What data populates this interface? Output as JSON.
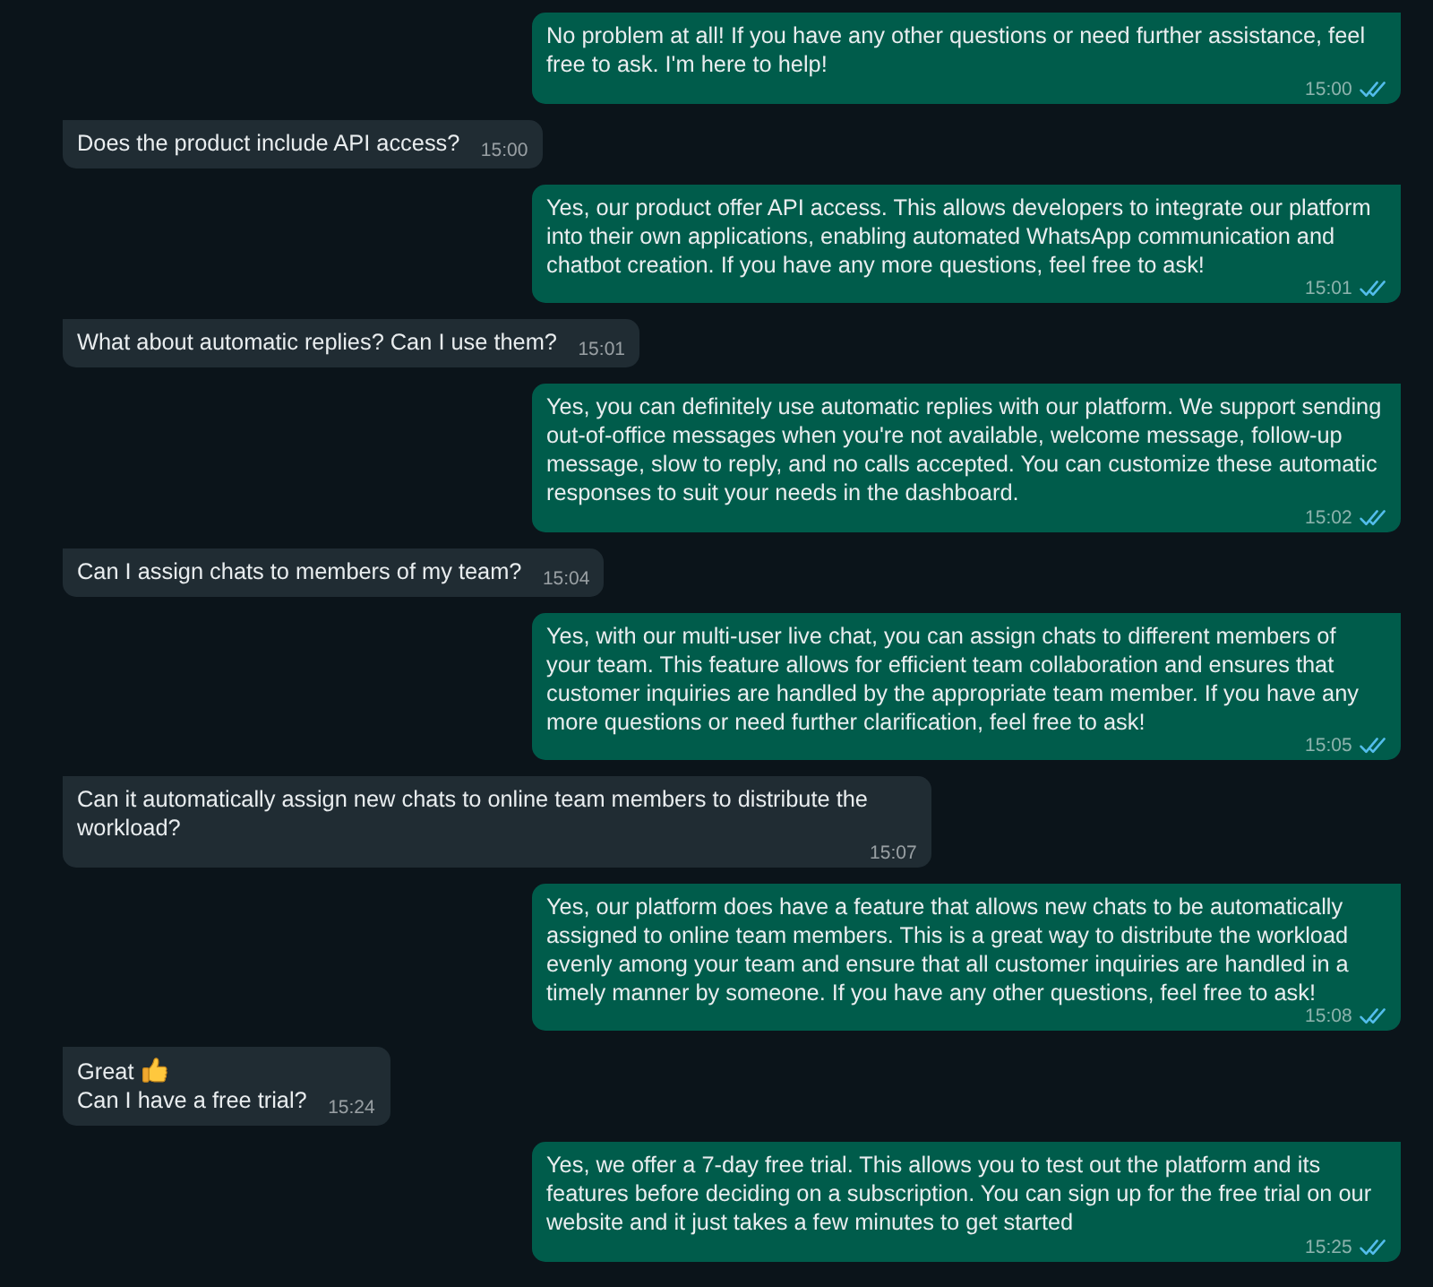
{
  "messages": [
    {
      "kind": "outgoing",
      "paragraphs": [
        {
          "text": "No problem at all! If you have any other questions or need further assistance, feel free to ask. I'm here to help!",
          "thumbs_up": false
        }
      ],
      "time": "15:00",
      "read": true
    },
    {
      "kind": "incoming",
      "paragraphs": [
        {
          "text": "Does the product include API access?",
          "thumbs_up": false
        }
      ],
      "time": "15:00"
    },
    {
      "kind": "outgoing",
      "paragraphs": [
        {
          "text": "Yes, our product offer API access. This allows developers to integrate our platform into their own applications, enabling automated WhatsApp communication and chatbot creation. If you have any more questions, feel free to ask!",
          "thumbs_up": false
        }
      ],
      "time": "15:01",
      "read": true
    },
    {
      "kind": "incoming",
      "paragraphs": [
        {
          "text": "What about automatic replies? Can I use them?",
          "thumbs_up": false
        }
      ],
      "time": "15:01"
    },
    {
      "kind": "outgoing",
      "paragraphs": [
        {
          "text": "Yes, you can definitely use automatic replies with our platform. We support sending out-of-office messages when you're not available, welcome message, follow-up message, slow to reply, and no calls accepted. You can customize these automatic responses to suit your needs in the dashboard.",
          "thumbs_up": false
        }
      ],
      "time": "15:02",
      "read": true
    },
    {
      "kind": "incoming",
      "paragraphs": [
        {
          "text": "Can I assign chats to members of my team?",
          "thumbs_up": false
        }
      ],
      "time": "15:04"
    },
    {
      "kind": "outgoing",
      "paragraphs": [
        {
          "text": "Yes, with our multi-user live chat, you can assign chats to different members of your team. This feature allows for efficient team collaboration and ensures that customer inquiries are handled by the appropriate team member. If you have any more questions or need further clarification, feel free to ask!",
          "thumbs_up": false
        }
      ],
      "time": "15:05",
      "read": true
    },
    {
      "kind": "incoming",
      "paragraphs": [
        {
          "text": "Can it automatically assign new chats to online team members to distribute the workload?",
          "thumbs_up": false
        }
      ],
      "time": "15:07"
    },
    {
      "kind": "outgoing",
      "paragraphs": [
        {
          "text": "Yes, our platform does have a feature that allows new chats to be automatically assigned to online team members. This is a great way to distribute the workload evenly among your team and ensure that all customer inquiries are handled in a timely manner by someone. If you have any other questions, feel free to ask!",
          "thumbs_up": false
        }
      ],
      "time": "15:08",
      "read": true
    },
    {
      "kind": "incoming",
      "paragraphs": [
        {
          "text": "Great",
          "thumbs_up": true
        },
        {
          "text": "Can I have a free trial?",
          "thumbs_up": false
        }
      ],
      "time": "15:24"
    },
    {
      "kind": "outgoing",
      "paragraphs": [
        {
          "text": "Yes, we offer a 7-day free trial. This allows you to test out the platform and its features before deciding on a subscription. You can sign up for the free trial on our website and it just takes a few minutes to get started",
          "thumbs_up": false
        }
      ],
      "time": "15:25",
      "read": true
    }
  ]
}
